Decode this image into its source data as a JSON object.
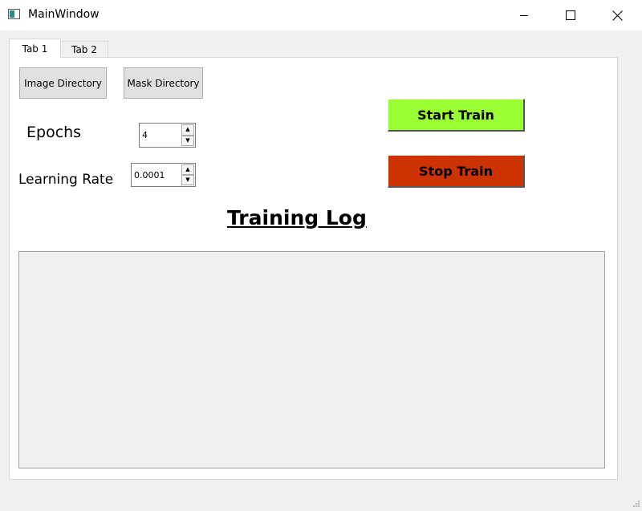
{
  "window": {
    "title": "MainWindow",
    "icons": {
      "app": "app-window-icon",
      "minimize": "minimize-icon",
      "maximize": "maximize-icon",
      "close": "close-icon"
    }
  },
  "tabs": [
    {
      "label": "Tab 1",
      "active": true
    },
    {
      "label": "Tab 2",
      "active": false
    }
  ],
  "buttons": {
    "image_directory": "Image Directory",
    "mask_directory": "Mask Directory",
    "start_train": "Start Train",
    "stop_train": "Stop Train"
  },
  "fields": {
    "epochs": {
      "label": "Epochs",
      "value": "4"
    },
    "learning_rate": {
      "label": "Learning Rate",
      "value": "0.0001"
    }
  },
  "log": {
    "title": "Training Log",
    "content": ""
  },
  "colors": {
    "start_button": "#99ff33",
    "stop_button": "#cc3300",
    "panel": "#ffffff",
    "background": "#f0f0f0"
  }
}
